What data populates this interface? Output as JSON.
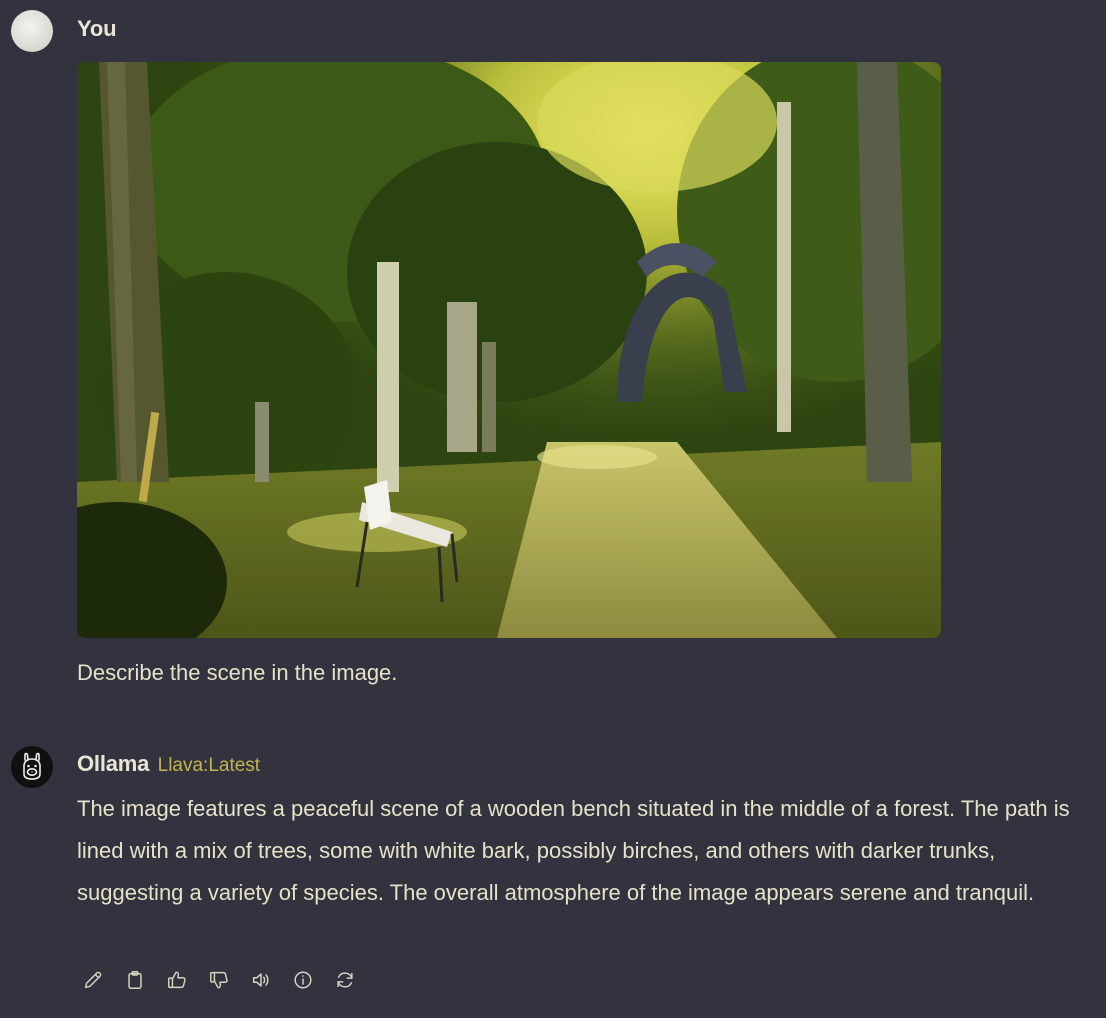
{
  "user_message": {
    "sender": "You",
    "text": "Describe the scene in the image."
  },
  "assistant_message": {
    "sender": "Ollama",
    "model": "Llava:Latest",
    "text": "The image features a peaceful scene of a wooden bench situated in the middle of a forest. The path is lined with a mix of trees, some with white bark, possibly birches, and others with darker trunks, suggesting a variety of species. The overall atmosphere of the image appears serene and tranquil."
  },
  "actions": [
    {
      "name": "edit-button",
      "icon": "pencil-icon"
    },
    {
      "name": "copy-button",
      "icon": "clipboard-icon"
    },
    {
      "name": "good-response-button",
      "icon": "thumbs-up-icon"
    },
    {
      "name": "bad-response-button",
      "icon": "thumbs-down-icon"
    },
    {
      "name": "read-aloud-button",
      "icon": "speaker-icon"
    },
    {
      "name": "generation-info-button",
      "icon": "info-icon"
    },
    {
      "name": "regenerate-button",
      "icon": "refresh-icon"
    }
  ],
  "colors": {
    "background": "#33323f",
    "text": "#e6e2c8",
    "model_tag": "#c2b44f"
  }
}
